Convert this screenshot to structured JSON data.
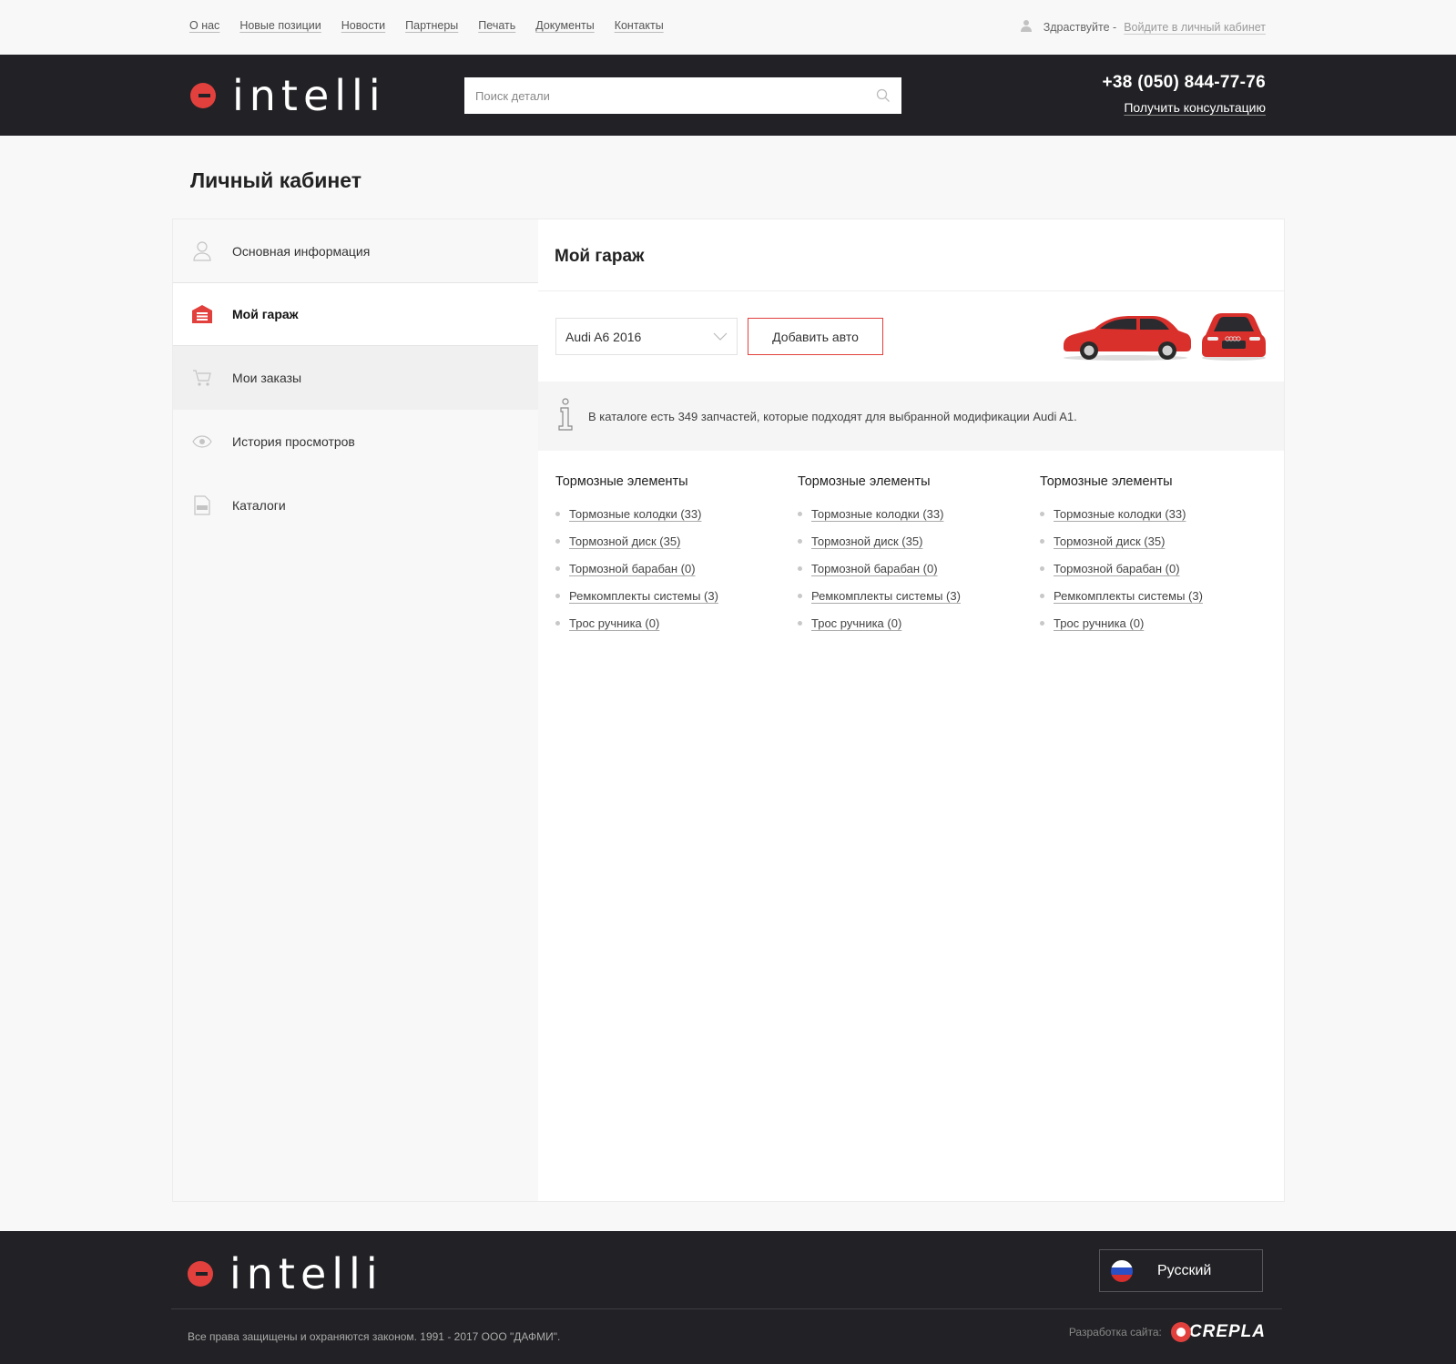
{
  "topnav": {
    "items": [
      "О нас",
      "Новые позиции",
      "Новости",
      "Партнеры",
      "Печать",
      "Документы",
      "Контакты"
    ],
    "greeting": "Здраствуйте -",
    "login": "Войдите в личный кабинет"
  },
  "header": {
    "logo_text": "intelli",
    "search_placeholder": "Поиск детали",
    "phone": "+38 (050) 844-77-76",
    "consult": "Получить консультацию"
  },
  "page": {
    "title": "Личный кабинет"
  },
  "sidebar": {
    "items": [
      {
        "label": "Основная информация",
        "icon": "user-icon"
      },
      {
        "label": "Мой гараж",
        "icon": "garage-icon"
      },
      {
        "label": "Мои заказы",
        "icon": "cart-icon"
      },
      {
        "label": "История просмотров",
        "icon": "eye-icon"
      },
      {
        "label": "Каталоги",
        "icon": "pdf-icon"
      }
    ]
  },
  "garage": {
    "title": "Мой гараж",
    "selected_car": "Audi A6 2016",
    "add_button": "Добавить авто",
    "info": "В каталоге есть 349 запчастей, которые подходят для выбранной модификации Audi A1.",
    "columns": [
      {
        "heading": "Тормозные элементы",
        "items": [
          "Тормозные колодки (33)",
          "Тормозной диск (35)",
          "Тормозной барабан (0)",
          "Ремкомплекты системы (3)",
          "Трос ручника (0)"
        ]
      },
      {
        "heading": "Тормозные элементы",
        "items": [
          "Тормозные колодки (33)",
          "Тормозной диск (35)",
          "Тормозной барабан (0)",
          "Ремкомплекты системы (3)",
          "Трос ручника (0)"
        ]
      },
      {
        "heading": "Тормозные элементы",
        "items": [
          "Тормозные колодки (33)",
          "Тормозной диск (35)",
          "Тормозной барабан (0)",
          "Ремкомплекты системы (3)",
          "Трос ручника (0)"
        ]
      }
    ]
  },
  "footer": {
    "logo_text": "intelli",
    "language": "Русский",
    "copyright": "Все права защищены и охраняются законом. 1991 - 2017 ООО \"ДАФМИ\".",
    "dev_label": "Разработка сайта:",
    "dev_brand": "CREPLA"
  },
  "colors": {
    "accent": "#e2403d",
    "dark": "#222226",
    "background": "#f8f8f8"
  }
}
